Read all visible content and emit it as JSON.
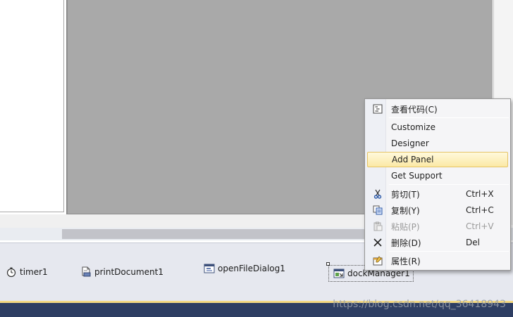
{
  "tray": {
    "items": [
      {
        "label": "timer1",
        "icon": "stopwatch-icon"
      },
      {
        "label": "printDocument1",
        "icon": "document-printer-icon"
      },
      {
        "label": "openFileDialog1",
        "icon": "dialog-window-icon"
      },
      {
        "label": "dockManager1",
        "icon": "dock-manager-icon"
      }
    ]
  },
  "context_menu": {
    "items": [
      {
        "label": "查看代码(C)",
        "icon": "view-code-icon",
        "shortcut": ""
      },
      {
        "label": "Customize",
        "icon": "",
        "shortcut": ""
      },
      {
        "label": "Designer",
        "icon": "",
        "shortcut": ""
      },
      {
        "label": "Add Panel",
        "icon": "",
        "shortcut": ""
      },
      {
        "label": "Get Support",
        "icon": "",
        "shortcut": ""
      },
      {
        "label": "剪切(T)",
        "icon": "scissors-icon",
        "shortcut": "Ctrl+X"
      },
      {
        "label": "复制(Y)",
        "icon": "copy-icon",
        "shortcut": "Ctrl+C"
      },
      {
        "label": "粘贴(P)",
        "icon": "paste-icon",
        "shortcut": "Ctrl+V"
      },
      {
        "label": "删除(D)",
        "icon": "delete-x-icon",
        "shortcut": "Del"
      },
      {
        "label": "属性(R)",
        "icon": "properties-icon",
        "shortcut": ""
      }
    ],
    "highlighted": "Add Panel",
    "disabled": [
      "粘贴(P)"
    ]
  },
  "watermark": "https://blog.csdn.net/qq_36418943",
  "colors": {
    "designer_gray": "#a9a9a9",
    "tray_background": "#e6e8ef",
    "menu_highlight": "#fbe9a5",
    "bottom_bar": "#2e3e63"
  }
}
